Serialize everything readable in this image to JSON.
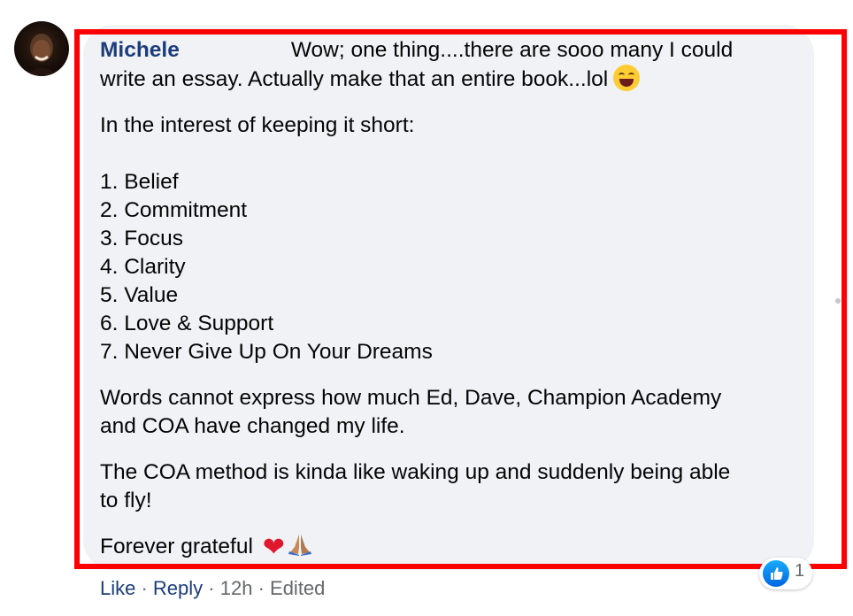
{
  "comment": {
    "author": "Michele",
    "first_line": "Wow; one thing....there are sooo many I could",
    "second_line": "write an essay. Actually make that an entire book...lol",
    "intro": "In the interest of keeping it short:",
    "list": [
      "1. Belief",
      "2. Commitment",
      "3. Focus",
      "4. Clarity",
      "5. Value",
      "6. Love & Support",
      "7. Never Give Up On Your Dreams"
    ],
    "paragraph1_line1": "Words cannot express how much Ed, Dave, Champion Academy",
    "paragraph1_line2": "and COA have changed my life.",
    "paragraph2_line1": "The COA method is kinda like waking up and suddenly being able",
    "paragraph2_line2": "to fly!",
    "closing": "Forever grateful",
    "heart_glyph": "❤"
  },
  "actions": {
    "like": "Like",
    "sep1": " · ",
    "reply": "Reply",
    "sep2": " · ",
    "time": "12h",
    "sep3": " · ",
    "edited": "Edited"
  },
  "reactions": {
    "count": "1"
  },
  "colors": {
    "highlight": "#ff0000",
    "bubble": "#f0f2f5",
    "author": "#1c3d7a"
  }
}
